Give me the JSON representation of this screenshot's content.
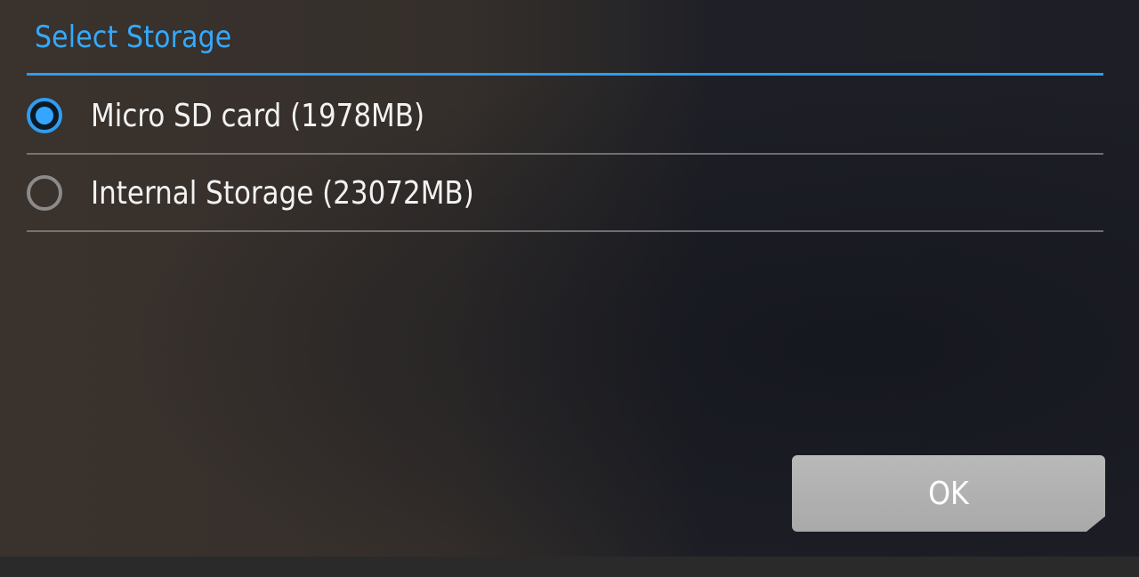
{
  "dialog": {
    "title": "Select Storage",
    "options": [
      {
        "label": "Micro SD card (1978MB)",
        "selected": true
      },
      {
        "label": "Internal Storage (23072MB)",
        "selected": false
      }
    ],
    "ok_label": "OK"
  },
  "colors": {
    "accent": "#33aaff",
    "radio_unchecked": "#8b8b8b",
    "button_bg": "#b3b3b3",
    "text": "#f2f2f2"
  }
}
